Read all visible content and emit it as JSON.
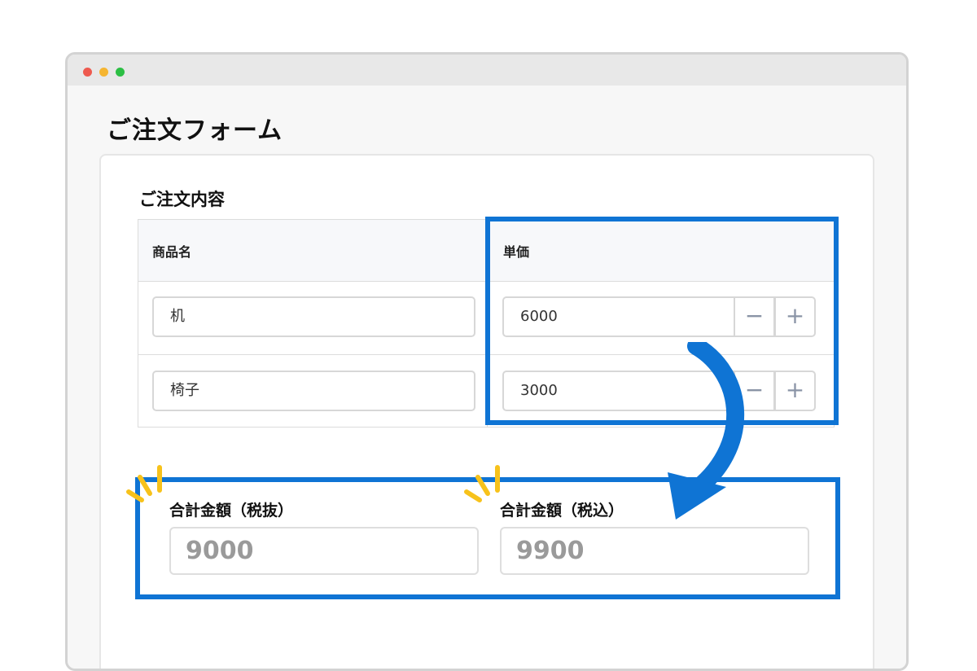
{
  "page": {
    "title": "ご注文フォーム"
  },
  "order": {
    "section_title": "ご注文内容",
    "columns": [
      "商品名",
      "単価"
    ],
    "rows": [
      {
        "name": "机",
        "price": "6000"
      },
      {
        "name": "椅子",
        "price": "3000"
      }
    ],
    "stepper": {
      "minus": "−",
      "plus": "+"
    }
  },
  "totals": {
    "excl_label": "合計金額（税抜）",
    "excl_value": "9000",
    "incl_label": "合計金額（税込）",
    "incl_value": "9900"
  },
  "colors": {
    "highlight": "#0f74d4",
    "sparkle": "#f7c21b",
    "window_dots": [
      "#ee5a4f",
      "#f5b531",
      "#2cbf44"
    ]
  },
  "icons": [
    "minus-icon",
    "plus-icon",
    "curved-arrow-icon",
    "sparkle-icon"
  ]
}
